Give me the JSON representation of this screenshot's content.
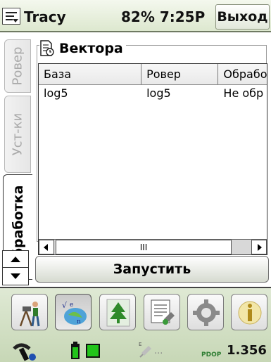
{
  "titlebar": {
    "app_title": "Tracy",
    "status_text": "82% 7:25P",
    "exit_label": "Выход"
  },
  "tabs": [
    {
      "label": "Ровер",
      "active": false
    },
    {
      "label": "Уст-ки",
      "active": false
    },
    {
      "label": "Обработка",
      "active": true
    }
  ],
  "vectors": {
    "title": "Вектора",
    "columns": [
      "База",
      "Ровер",
      "Обработ"
    ],
    "rows": [
      [
        "log5",
        "log5",
        "Не обр"
      ]
    ],
    "scroll_thumb": "III"
  },
  "run_label": "Запустить",
  "toolbar": {
    "icons": [
      "surveyor-icon",
      "formula-icon",
      "tree-icon",
      "log-icon",
      "settings-icon",
      "info-icon"
    ],
    "pressed": "formula-icon"
  },
  "statusbar": {
    "icons": [
      "satellite-icon",
      "battery-icon",
      "memory-chip-icon",
      "plug-icon"
    ],
    "dots": "...",
    "pdop_label": "PDOP",
    "pdop_value": "1.356"
  },
  "colors": {
    "toolbar_bg": "#c7d7b6",
    "title_bg": "#dde8cf",
    "battery_green": "#22c41a"
  }
}
